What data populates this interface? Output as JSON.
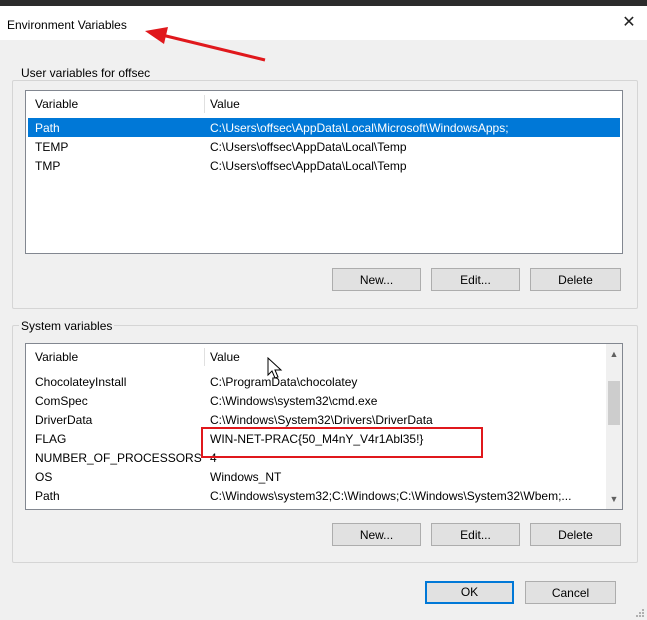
{
  "dialog": {
    "title": "Environment Variables",
    "close_glyph": "✕"
  },
  "user_vars": {
    "group_label": "User variables for offsec",
    "columns": [
      "Variable",
      "Value"
    ],
    "rows": [
      {
        "variable": "Path",
        "value": "C:\\Users\\offsec\\AppData\\Local\\Microsoft\\WindowsApps;"
      },
      {
        "variable": "TEMP",
        "value": "C:\\Users\\offsec\\AppData\\Local\\Temp"
      },
      {
        "variable": "TMP",
        "value": "C:\\Users\\offsec\\AppData\\Local\\Temp"
      }
    ],
    "selected_index": 0,
    "buttons": {
      "new": "New...",
      "edit": "Edit...",
      "delete": "Delete"
    }
  },
  "system_vars": {
    "group_label": "System variables",
    "columns": [
      "Variable",
      "Value"
    ],
    "rows": [
      {
        "variable": "ChocolateyInstall",
        "value": "C:\\ProgramData\\chocolatey"
      },
      {
        "variable": "ComSpec",
        "value": "C:\\Windows\\system32\\cmd.exe"
      },
      {
        "variable": "DriverData",
        "value": "C:\\Windows\\System32\\Drivers\\DriverData"
      },
      {
        "variable": "FLAG",
        "value": "WIN-NET-PRAC{50_M4nY_V4r1Abl35!}"
      },
      {
        "variable": "NUMBER_OF_PROCESSORS",
        "value": "4"
      },
      {
        "variable": "OS",
        "value": "Windows_NT"
      },
      {
        "variable": "Path",
        "value": "C:\\Windows\\system32;C:\\Windows;C:\\Windows\\System32\\Wbem;..."
      }
    ],
    "buttons": {
      "new": "New...",
      "edit": "Edit...",
      "delete": "Delete"
    }
  },
  "footer": {
    "ok": "OK",
    "cancel": "Cancel"
  },
  "annotation_colors": {
    "arrow": "#e0181c",
    "box": "#e0181c",
    "accent": "#0078d7"
  },
  "icons": {
    "close": "close-icon",
    "scroll_up": "scroll-up-icon",
    "scroll_down": "scroll-down-icon",
    "cursor": "mouse-cursor-icon",
    "arrow": "annotation-arrow"
  }
}
